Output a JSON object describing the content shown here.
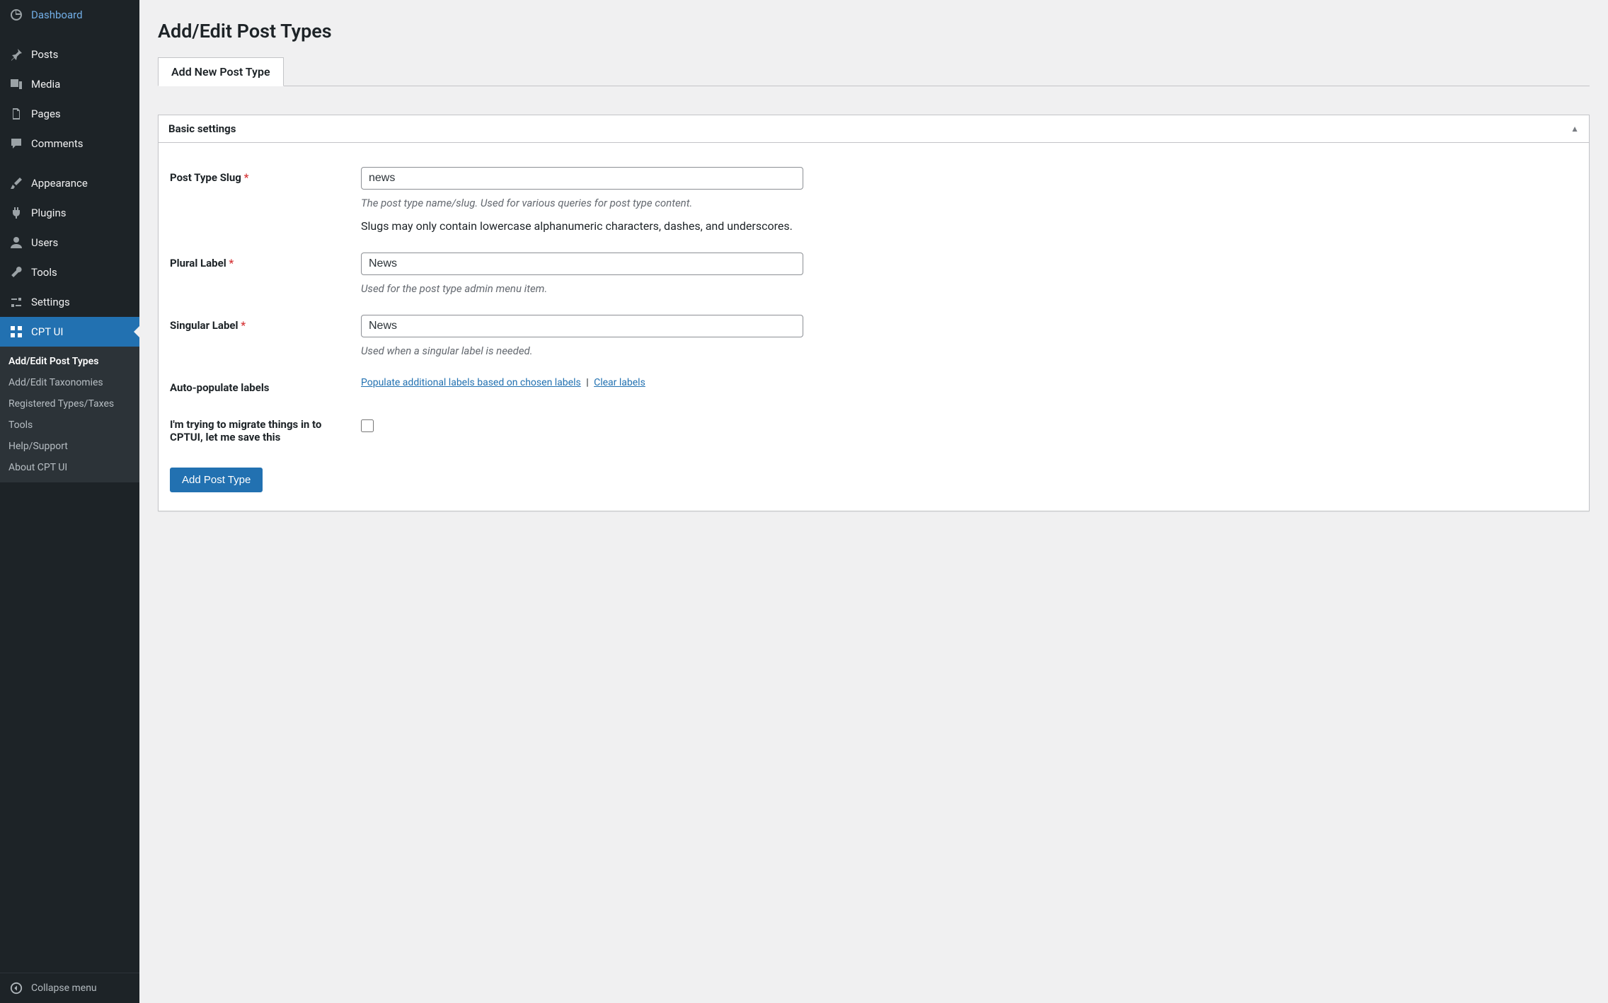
{
  "sidebar": {
    "items": [
      {
        "label": "Dashboard"
      },
      {
        "label": "Posts"
      },
      {
        "label": "Media"
      },
      {
        "label": "Pages"
      },
      {
        "label": "Comments"
      },
      {
        "label": "Appearance"
      },
      {
        "label": "Plugins"
      },
      {
        "label": "Users"
      },
      {
        "label": "Tools"
      },
      {
        "label": "Settings"
      },
      {
        "label": "CPT UI"
      }
    ],
    "submenu": [
      {
        "label": "Add/Edit Post Types"
      },
      {
        "label": "Add/Edit Taxonomies"
      },
      {
        "label": "Registered Types/Taxes"
      },
      {
        "label": "Tools"
      },
      {
        "label": "Help/Support"
      },
      {
        "label": "About CPT UI"
      }
    ],
    "collapse_label": "Collapse menu"
  },
  "page": {
    "title": "Add/Edit Post Types",
    "tab": "Add New Post Type",
    "panel_title": "Basic settings"
  },
  "fields": {
    "slug": {
      "label": "Post Type Slug",
      "value": "news",
      "desc": "The post type name/slug. Used for various queries for post type content.",
      "note": "Slugs may only contain lowercase alphanumeric characters, dashes, and underscores."
    },
    "plural": {
      "label": "Plural Label",
      "value": "News",
      "desc": "Used for the post type admin menu item."
    },
    "singular": {
      "label": "Singular Label",
      "value": "News",
      "desc": "Used when a singular label is needed."
    },
    "autopop": {
      "label": "Auto-populate labels",
      "populate_link": "Populate additional labels based on chosen labels",
      "clear_link": "Clear labels",
      "sep": "|"
    },
    "migrate": {
      "label": "I'm trying to migrate things in to CPTUI, let me save this"
    },
    "submit": "Add Post Type"
  }
}
